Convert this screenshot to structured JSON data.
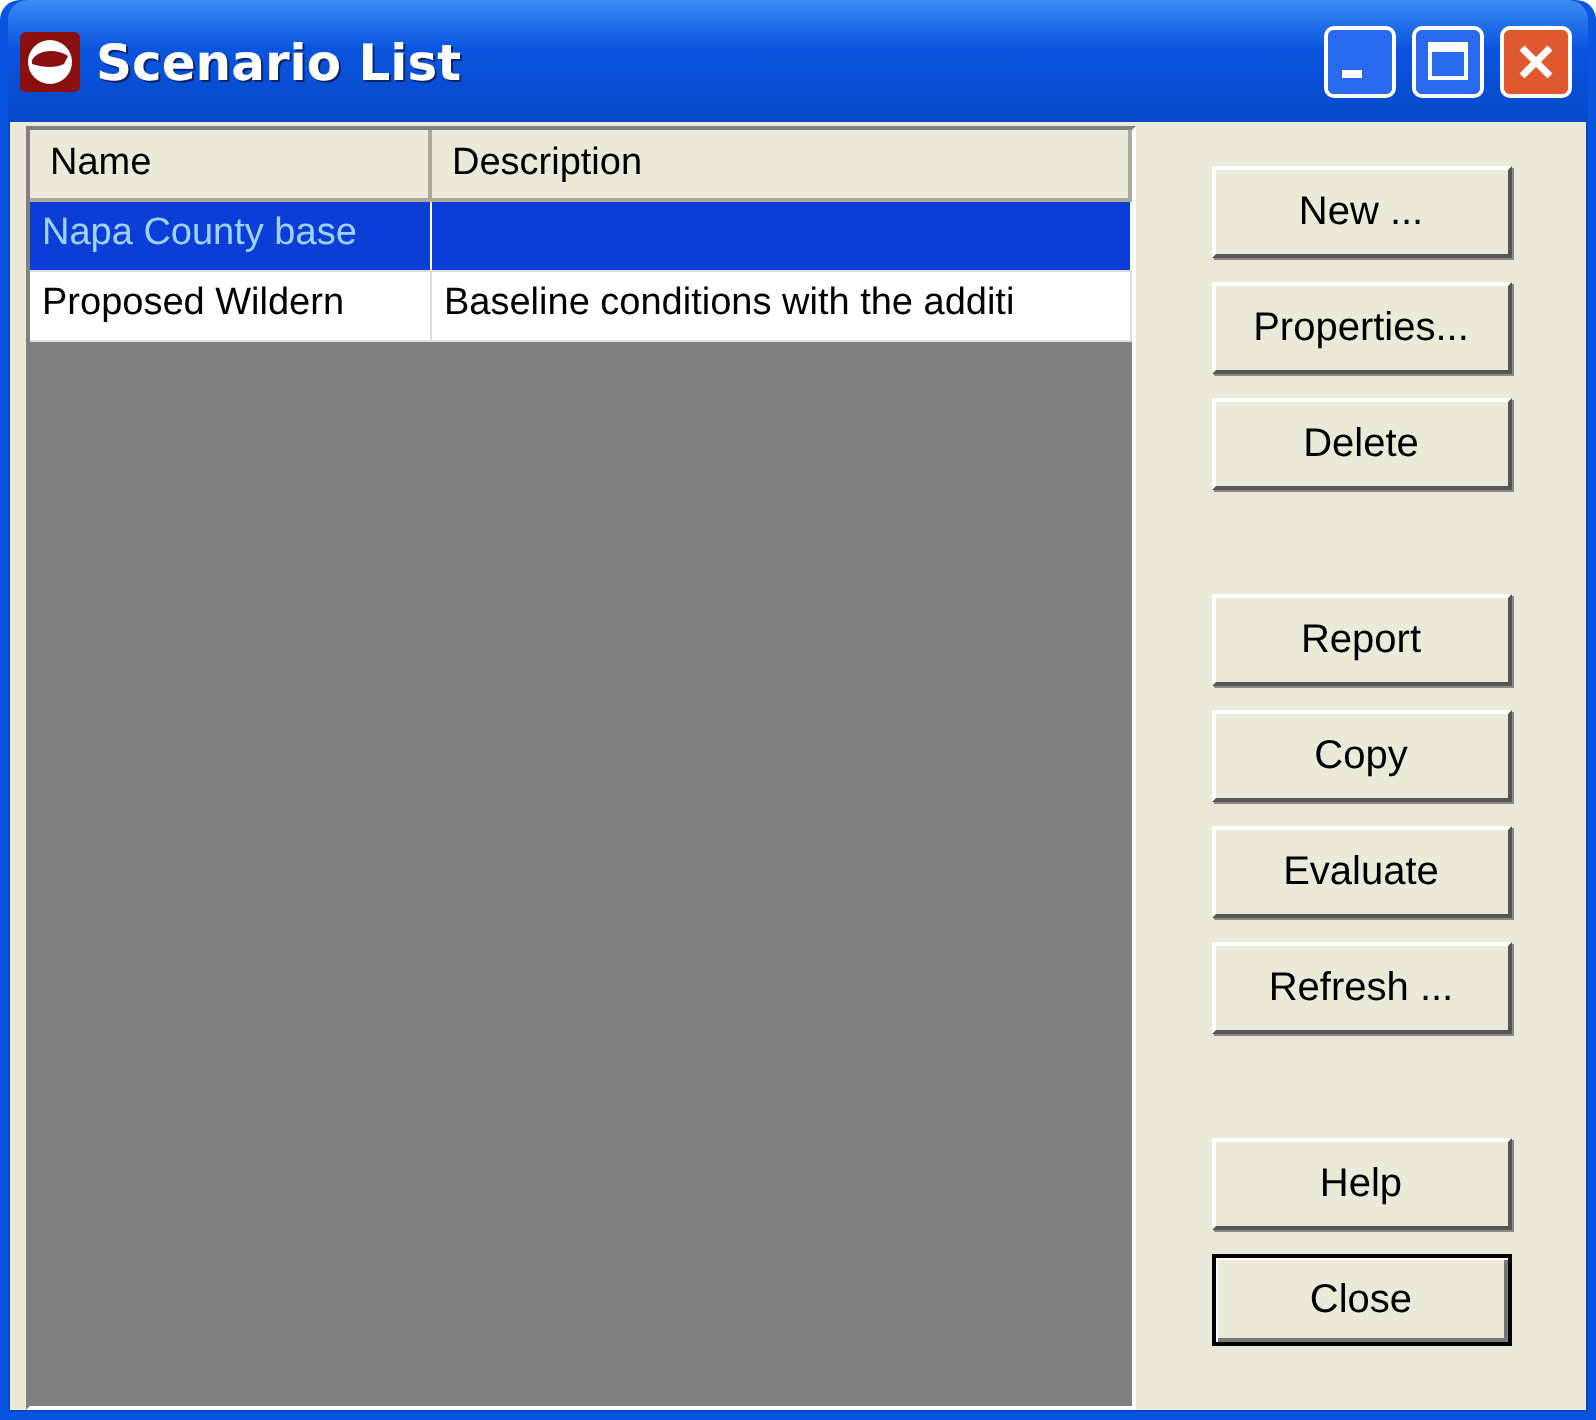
{
  "window": {
    "title": "Scenario List"
  },
  "table": {
    "columns": [
      "Name",
      "Description"
    ],
    "rows": [
      {
        "cells": [
          "Napa County base",
          ""
        ],
        "selected": true
      },
      {
        "cells": [
          "Proposed Wildern",
          "Baseline  conditions  with  the additi"
        ],
        "selected": false
      }
    ]
  },
  "button_groups": [
    [
      {
        "label": "New ...",
        "default": false
      },
      {
        "label": "Properties...",
        "default": false
      },
      {
        "label": "Delete",
        "default": false
      }
    ],
    [
      {
        "label": "Report",
        "default": false
      },
      {
        "label": "Copy",
        "default": false
      },
      {
        "label": "Evaluate",
        "default": false
      },
      {
        "label": "Refresh ...",
        "default": false
      }
    ],
    [
      {
        "label": "Help",
        "default": false
      },
      {
        "label": "Close",
        "default": true
      }
    ]
  ]
}
